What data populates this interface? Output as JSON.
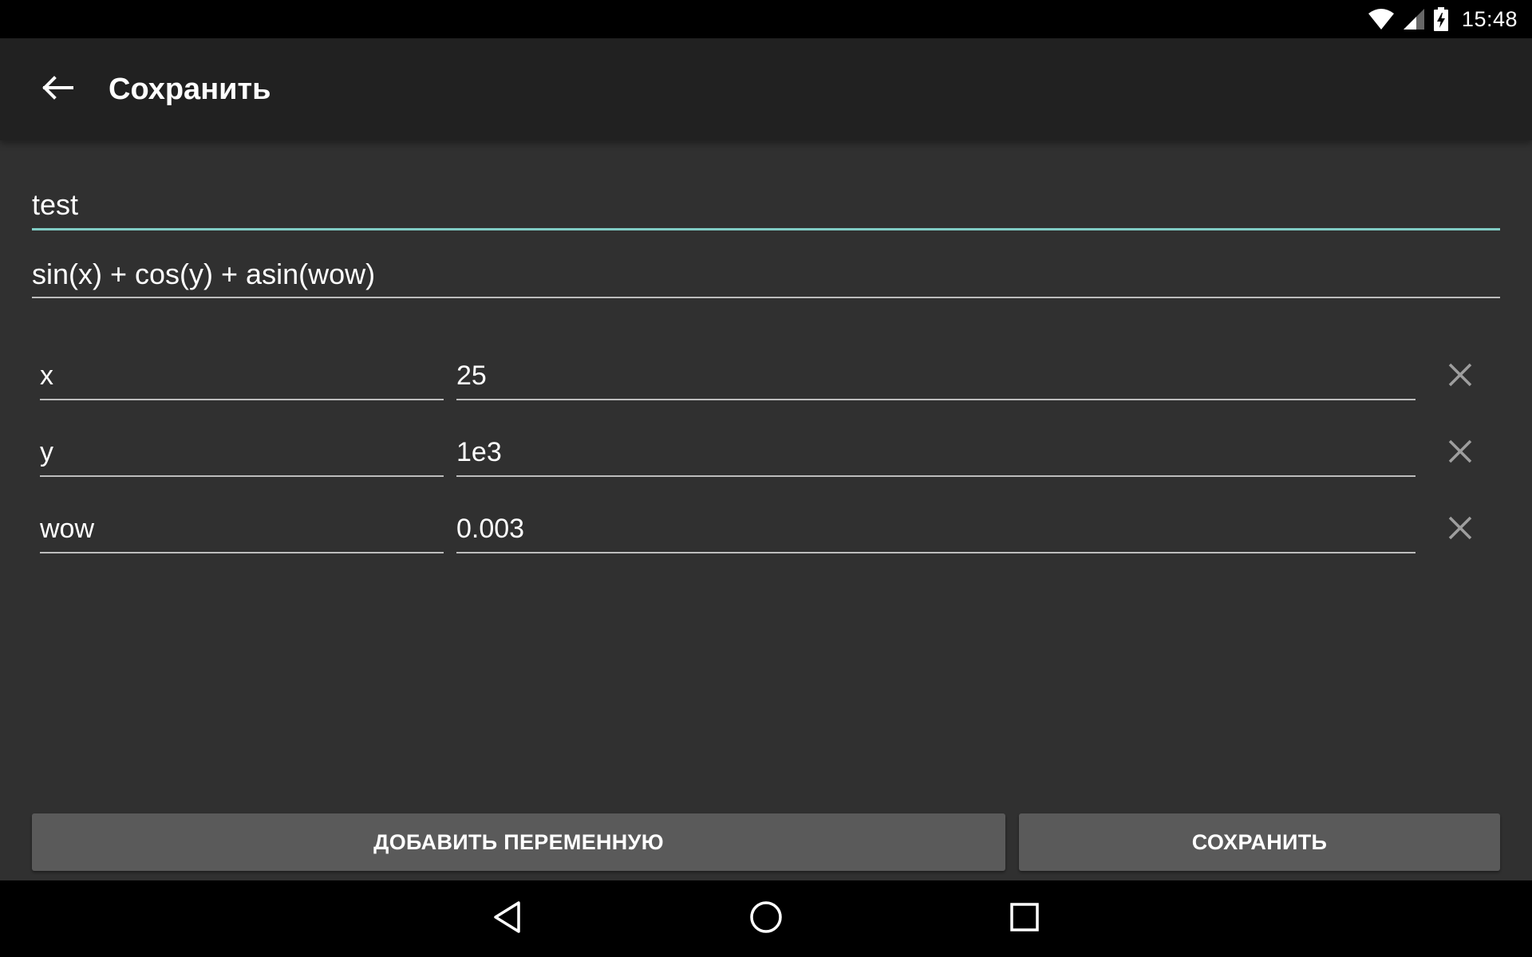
{
  "status_bar": {
    "time": "15:48",
    "icons": [
      "wifi-icon",
      "cell-signal-icon",
      "battery-charging-icon"
    ]
  },
  "app_bar": {
    "back_icon": "arrow-left-icon",
    "title": "Сохранить"
  },
  "form": {
    "name_value": "test",
    "formula_value": "sin(x) + cos(y) + asin(wow)",
    "variables": [
      {
        "name": "x",
        "value": "25"
      },
      {
        "name": "y",
        "value": "1e3"
      },
      {
        "name": "wow",
        "value": "0.003"
      }
    ],
    "remove_icon": "close-icon"
  },
  "actions": {
    "add_variable_label": "ДОБАВИТЬ ПЕРЕМЕННУЮ",
    "save_label": "СОХРАНИТЬ"
  },
  "nav_bar": {
    "icons": [
      "back-triangle-icon",
      "home-circle-icon",
      "recents-square-icon"
    ]
  },
  "colors": {
    "background": "#303030",
    "app_bar": "#212121",
    "accent": "#80cbc4",
    "button": "#5a5a5a"
  }
}
